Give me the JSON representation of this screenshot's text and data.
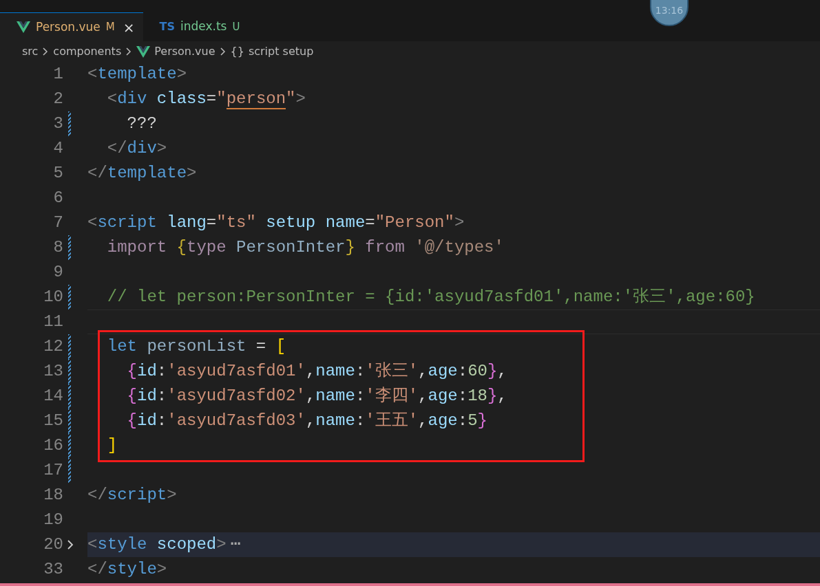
{
  "clock_badge": "13:16",
  "tabs": [
    {
      "kind": "vue",
      "label": "Person.vue",
      "status": "M",
      "close": "×",
      "selected": true
    },
    {
      "kind": "ts",
      "icon_text": "TS",
      "label": "index.ts",
      "status": "U",
      "selected": false
    }
  ],
  "breadcrumb": [
    {
      "kind": "folder",
      "label": "src"
    },
    {
      "kind": "folder",
      "label": "components"
    },
    {
      "kind": "vue",
      "label": "Person.vue"
    },
    {
      "kind": "symbol",
      "prefix": "{}",
      "label": "script setup"
    }
  ],
  "lines": [
    {
      "number": "1",
      "tokens": [
        {
          "text": "<",
          "kind": "punct"
        },
        {
          "text": "template",
          "kind": "tag"
        },
        {
          "text": ">",
          "kind": "punct"
        }
      ]
    },
    {
      "number": "2",
      "tokens": [
        {
          "text": "  <",
          "kind": "punct"
        },
        {
          "text": "div",
          "kind": "tag"
        },
        {
          "text": " class",
          "kind": "attr"
        },
        {
          "text": "=",
          "kind": "plain"
        },
        {
          "text": "\"",
          "kind": "string"
        },
        {
          "text": "person",
          "kind": "underlined"
        },
        {
          "text": "\"",
          "kind": "string"
        },
        {
          "text": ">",
          "kind": "punct"
        }
      ]
    },
    {
      "number": "3",
      "modified": true,
      "tokens": [
        {
          "text": "    ???",
          "kind": "plain"
        }
      ]
    },
    {
      "number": "4",
      "tokens": [
        {
          "text": "  </",
          "kind": "punct"
        },
        {
          "text": "div",
          "kind": "tag"
        },
        {
          "text": ">",
          "kind": "punct"
        }
      ]
    },
    {
      "number": "5",
      "tokens": [
        {
          "text": "</",
          "kind": "punct"
        },
        {
          "text": "template",
          "kind": "tag"
        },
        {
          "text": ">",
          "kind": "punct"
        }
      ]
    },
    {
      "number": "6"
    },
    {
      "number": "7",
      "tokens": [
        {
          "text": "<",
          "kind": "punct"
        },
        {
          "text": "script",
          "kind": "tag"
        },
        {
          "text": " lang",
          "kind": "attr"
        },
        {
          "text": "=",
          "kind": "plain"
        },
        {
          "text": "\"ts\"",
          "kind": "string"
        },
        {
          "text": " setup",
          "kind": "attr"
        },
        {
          "text": " name",
          "kind": "attr"
        },
        {
          "text": "=",
          "kind": "plain"
        },
        {
          "text": "\"Person\"",
          "kind": "string"
        },
        {
          "text": ">",
          "kind": "punct"
        }
      ]
    },
    {
      "number": "8",
      "modified": true,
      "tokens": [
        {
          "text": "  import",
          "kind": "keyword"
        },
        {
          "text": " {",
          "kind": "bracedim"
        },
        {
          "text": "type",
          "kind": "keyword"
        },
        {
          "text": " PersonInter",
          "kind": "identdim"
        },
        {
          "text": "}",
          "kind": "bracedim"
        },
        {
          "text": " from",
          "kind": "keyword"
        },
        {
          "text": " '@/types'",
          "kind": "stringdim"
        }
      ]
    },
    {
      "number": "9"
    },
    {
      "number": "10",
      "modified": true,
      "tokens": [
        {
          "text": "  // let person:PersonInter = {id:'asyud7asfd01',name:'张三',age:60}",
          "kind": "comment"
        }
      ]
    },
    {
      "number": "11",
      "current": true
    },
    {
      "number": "12",
      "modified": true,
      "highlighted": true,
      "tokens": [
        {
          "text": "  let",
          "kind": "storage"
        },
        {
          "text": " personList",
          "kind": "identdim"
        },
        {
          "text": " = ",
          "kind": "plain"
        },
        {
          "text": "[",
          "kind": "brace"
        }
      ]
    },
    {
      "number": "13",
      "modified": true,
      "highlighted": true,
      "tokens": [
        {
          "text": "    {",
          "kind": "brace2"
        },
        {
          "text": "id",
          "kind": "attr"
        },
        {
          "text": ":",
          "kind": "plain"
        },
        {
          "text": "'asyud7asfd01'",
          "kind": "string"
        },
        {
          "text": ",",
          "kind": "plain"
        },
        {
          "text": "name",
          "kind": "attr"
        },
        {
          "text": ":",
          "kind": "plain"
        },
        {
          "text": "'张三'",
          "kind": "string"
        },
        {
          "text": ",",
          "kind": "plain"
        },
        {
          "text": "age",
          "kind": "attr"
        },
        {
          "text": ":",
          "kind": "plain"
        },
        {
          "text": "60",
          "kind": "number"
        },
        {
          "text": "}",
          "kind": "brace2"
        },
        {
          "text": ",",
          "kind": "plain"
        }
      ]
    },
    {
      "number": "14",
      "modified": true,
      "highlighted": true,
      "tokens": [
        {
          "text": "    {",
          "kind": "brace2"
        },
        {
          "text": "id",
          "kind": "attr"
        },
        {
          "text": ":",
          "kind": "plain"
        },
        {
          "text": "'asyud7asfd02'",
          "kind": "string"
        },
        {
          "text": ",",
          "kind": "plain"
        },
        {
          "text": "name",
          "kind": "attr"
        },
        {
          "text": ":",
          "kind": "plain"
        },
        {
          "text": "'李四'",
          "kind": "string"
        },
        {
          "text": ",",
          "kind": "plain"
        },
        {
          "text": "age",
          "kind": "attr"
        },
        {
          "text": ":",
          "kind": "plain"
        },
        {
          "text": "18",
          "kind": "number"
        },
        {
          "text": "}",
          "kind": "brace2"
        },
        {
          "text": ",",
          "kind": "plain"
        }
      ]
    },
    {
      "number": "15",
      "modified": true,
      "highlighted": true,
      "tokens": [
        {
          "text": "    {",
          "kind": "brace2"
        },
        {
          "text": "id",
          "kind": "attr"
        },
        {
          "text": ":",
          "kind": "plain"
        },
        {
          "text": "'asyud7asfd03'",
          "kind": "string"
        },
        {
          "text": ",",
          "kind": "plain"
        },
        {
          "text": "name",
          "kind": "attr"
        },
        {
          "text": ":",
          "kind": "plain"
        },
        {
          "text": "'王五'",
          "kind": "string"
        },
        {
          "text": ",",
          "kind": "plain"
        },
        {
          "text": "age",
          "kind": "attr"
        },
        {
          "text": ":",
          "kind": "plain"
        },
        {
          "text": "5",
          "kind": "number"
        },
        {
          "text": "}",
          "kind": "brace2"
        }
      ]
    },
    {
      "number": "16",
      "modified": true,
      "highlighted": true,
      "tokens": [
        {
          "text": "  ]",
          "kind": "brace"
        }
      ]
    },
    {
      "number": "17",
      "modified": true
    },
    {
      "number": "18",
      "tokens": [
        {
          "text": "</",
          "kind": "punct"
        },
        {
          "text": "script",
          "kind": "tag"
        },
        {
          "text": ">",
          "kind": "punct"
        }
      ]
    },
    {
      "number": "19"
    },
    {
      "number": "20",
      "folded": true,
      "fold_marker": "⋯",
      "tokens": [
        {
          "text": "<",
          "kind": "punct"
        },
        {
          "text": "style",
          "kind": "tag"
        },
        {
          "text": " scoped",
          "kind": "attr"
        },
        {
          "text": ">",
          "kind": "punct"
        }
      ]
    },
    {
      "number": "33",
      "tokens": [
        {
          "text": "</",
          "kind": "punct"
        },
        {
          "text": "style",
          "kind": "tag"
        },
        {
          "text": ">",
          "kind": "punct"
        }
      ]
    }
  ]
}
